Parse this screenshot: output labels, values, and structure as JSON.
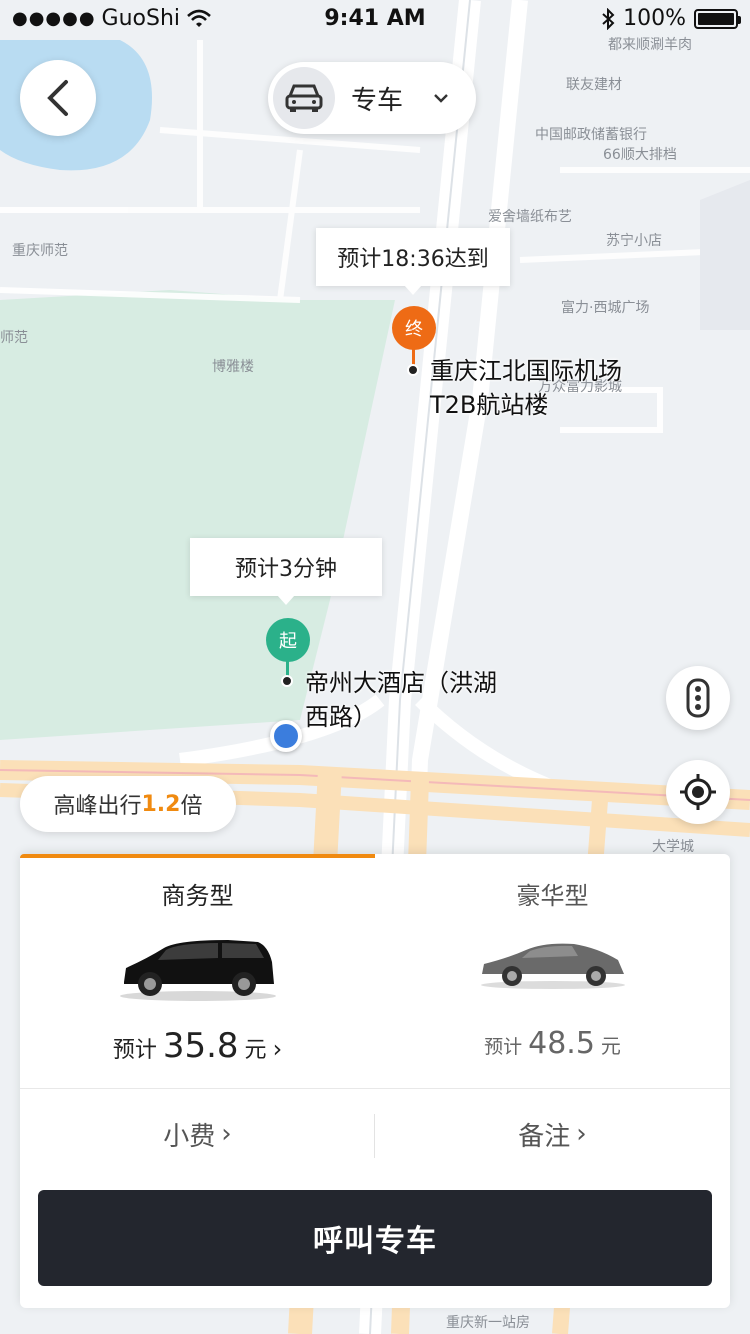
{
  "status_bar": {
    "signal": "●●●●●",
    "carrier": "GuoShi",
    "time": "9:41 AM",
    "battery": "100%"
  },
  "header": {
    "car_type": "专车"
  },
  "map": {
    "pois": [
      "都来顺涮羊肉",
      "联友建材",
      "中国邮政储蓄银行",
      "66顺大排档",
      "爱舍墙纸布艺",
      "苏宁小店",
      "重庆师范",
      "富力·西城广场",
      "师范",
      "博雅楼",
      "万众富力影城",
      "大学城",
      "重庆新一站房"
    ],
    "destination": {
      "eta": "预计18:36达到",
      "pin": "终",
      "name_line1": "重庆江北国际机场",
      "name_line2": "T2B航站楼"
    },
    "origin": {
      "eta": "预计3分钟",
      "pin": "起",
      "name_line1": "帝州大酒店（洪湖",
      "name_line2": "西路）"
    }
  },
  "surge": {
    "prefix": "高峰出行",
    "multiplier": "1.2",
    "suffix": "倍"
  },
  "panel": {
    "options": [
      {
        "name": "商务型",
        "price_label": "预计",
        "price": "35.8",
        "unit": "元",
        "arrow": "›"
      },
      {
        "name": "豪华型",
        "price_label": "预计",
        "price": "48.5",
        "unit": "元"
      }
    ],
    "tip": "小费",
    "note": "备注",
    "chevron": "›",
    "call_button": "呼叫专车"
  },
  "colors": {
    "accent": "#f08a10",
    "start_pin": "#2bb18a",
    "end_pin": "#ee6b15",
    "location": "#3b7ddd",
    "button": "#23262e"
  }
}
